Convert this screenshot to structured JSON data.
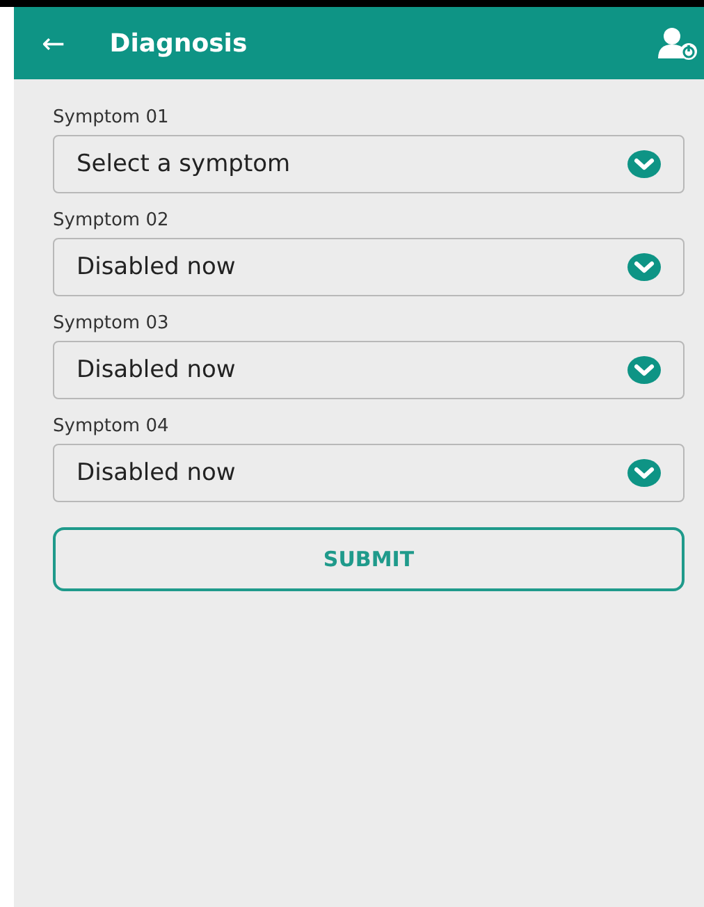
{
  "app_bar": {
    "back": "←",
    "title": "Diagnosis"
  },
  "fields": [
    {
      "label": "Symptom 01",
      "value": "Select a symptom"
    },
    {
      "label": "Symptom 02",
      "value": "Disabled now"
    },
    {
      "label": "Symptom 03",
      "value": "Disabled now"
    },
    {
      "label": "Symptom 04",
      "value": "Disabled now"
    }
  ],
  "submit": "SUBMIT"
}
